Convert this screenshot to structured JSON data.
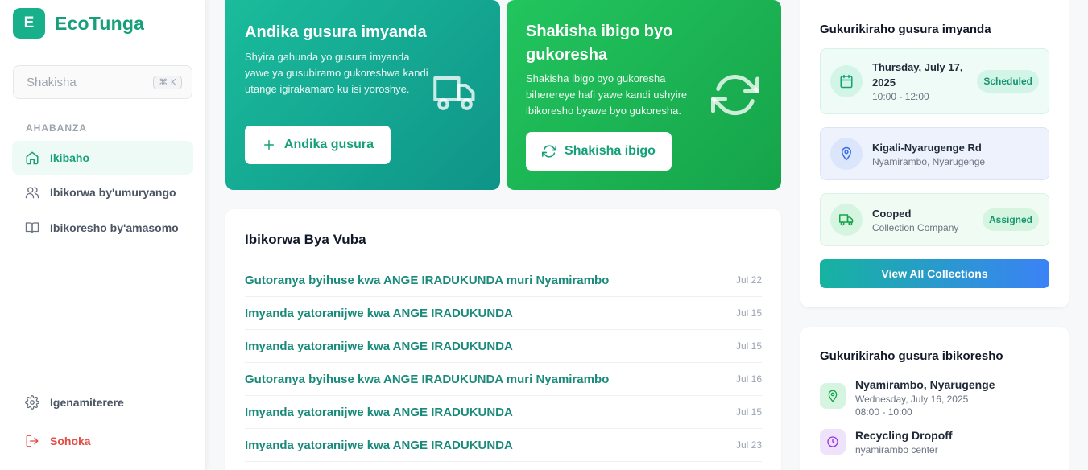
{
  "brand": {
    "logo_letter": "E",
    "name": "EcoTunga"
  },
  "search": {
    "placeholder": "Shakisha",
    "shortcut": "⌘ K"
  },
  "nav": {
    "section_label": "AHABANZA",
    "items": [
      {
        "label": "Ikibaho",
        "icon": "home-icon",
        "active": true
      },
      {
        "label": "Ibikorwa by'umuryango",
        "icon": "users-icon"
      },
      {
        "label": "Ibikoresho by'amasomo",
        "icon": "book-icon"
      }
    ],
    "settings_label": "Igenamiterere",
    "logout_label": "Sohoka"
  },
  "hero_schedule": {
    "title": "Andika gusura imyanda",
    "description": "Shyira gahunda yo gusura imyanda yawe ya gusubiramo gukoreshwa kandi utange igirakamaro ku isi yoroshye.",
    "button_label": "Andika gusura",
    "icon": "truck-icon"
  },
  "hero_find": {
    "title": "Shakisha ibigo byo gukoresha",
    "description": "Shakisha ibigo byo gukoresha biherereye hafi yawe kandi ushyire ibikoresho byawe byo gukoresha.",
    "button_label": "Shakisha ibigo",
    "icon": "recycle-icon"
  },
  "recent": {
    "title": "Ibikorwa Bya Vuba",
    "items": [
      {
        "title": "Gutoranya byihuse kwa ANGE IRADUKUNDA muri Nyamirambo",
        "date": "Jul 22"
      },
      {
        "title": "Imyanda yatoranijwe kwa ANGE IRADUKUNDA",
        "date": "Jul 15"
      },
      {
        "title": "Imyanda yatoranijwe kwa ANGE IRADUKUNDA",
        "date": "Jul 15"
      },
      {
        "title": "Gutoranya byihuse kwa ANGE IRADUKUNDA muri Nyamirambo",
        "date": "Jul 16"
      },
      {
        "title": "Imyanda yatoranijwe kwa ANGE IRADUKUNDA",
        "date": "Jul 15"
      },
      {
        "title": "Imyanda yatoranijwe kwa ANGE IRADUKUNDA",
        "date": "Jul 23"
      }
    ]
  },
  "tracking_waste": {
    "title": "Gukurikiraho gusura imyanda",
    "date_main": "Thursday, July 17, 2025",
    "date_time": "10:00 - 12:00",
    "date_badge": "Scheduled",
    "location_main": "Kigali-Nyarugenge Rd",
    "location_sub": "Nyamirambo, Nyarugenge",
    "company_main": "Cooped",
    "company_sub": "Collection Company",
    "company_badge": "Assigned",
    "view_all_label": "View All Collections"
  },
  "tracking_recycle": {
    "title": "Gukurikiraho gusura ibikoresho",
    "place_main": "Nyamirambo, Nyarugenge",
    "place_date": "Wednesday, July 16, 2025",
    "place_time": "08:00 - 10:00",
    "drop_main": "Recycling Dropoff",
    "drop_sub": "nyamirambo center"
  },
  "colors": {
    "brand": "#15a07a",
    "danger": "#e14c43",
    "accent_blue": "#3b82f6"
  }
}
